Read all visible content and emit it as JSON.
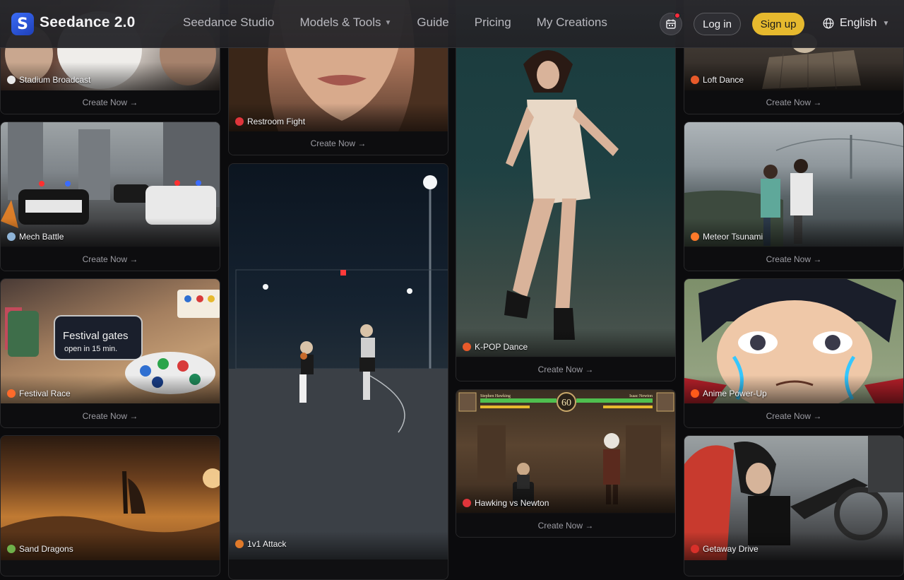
{
  "header": {
    "logo_letter": "S",
    "brand": "Seedance 2.0",
    "nav": [
      {
        "label": "Seedance Studio",
        "dropdown": false
      },
      {
        "label": "Models & Tools",
        "dropdown": true
      },
      {
        "label": "Guide",
        "dropdown": false
      },
      {
        "label": "Pricing",
        "dropdown": false
      },
      {
        "label": "My Creations",
        "dropdown": false
      }
    ],
    "login_label": "Log in",
    "signup_label": "Sign up",
    "language": "English",
    "accent_color": "#e6b92e",
    "notification_color": "#ff2b3d"
  },
  "cards": [
    {
      "title": "Stadium Broadcast",
      "cta": "Create Now →",
      "icon": "baseball-icon"
    },
    {
      "title": "Restroom Fight",
      "cta": "Create Now →",
      "icon": "boxing-glove-icon"
    },
    {
      "title": "K-POP Dance",
      "cta": "Create Now →",
      "icon": "dancer-icon"
    },
    {
      "title": "Loft Dance",
      "cta": "Create Now →",
      "icon": "dancer-icon"
    },
    {
      "title": "Mech Battle",
      "cta": "Create Now →",
      "icon": "robot-icon"
    },
    {
      "title": "Meteor Tsunami",
      "cta": "Create Now →",
      "icon": "meteor-icon"
    },
    {
      "title": "Festival Race",
      "cta": "Create Now →",
      "icon": "flower-icon"
    },
    {
      "title": "1v1 Attack",
      "cta": "",
      "icon": "basketball-icon"
    },
    {
      "title": "Hawking vs Newton",
      "cta": "Create Now →",
      "icon": "boxing-glove-icon"
    },
    {
      "title": "Anime Power-Up",
      "cta": "Create Now →",
      "icon": "fire-icon"
    },
    {
      "title": "Sand Dragons",
      "cta": "",
      "icon": "dragon-icon"
    },
    {
      "title": "Getaway Drive",
      "cta": "",
      "icon": "race-car-icon"
    }
  ],
  "scene_text": {
    "phone_line1": "Festival gates",
    "phone_line2": "open in 15 min.",
    "game_timer": "60",
    "game_left_name": "Stephen Hawking",
    "game_right_name": "Isaac Newton"
  }
}
